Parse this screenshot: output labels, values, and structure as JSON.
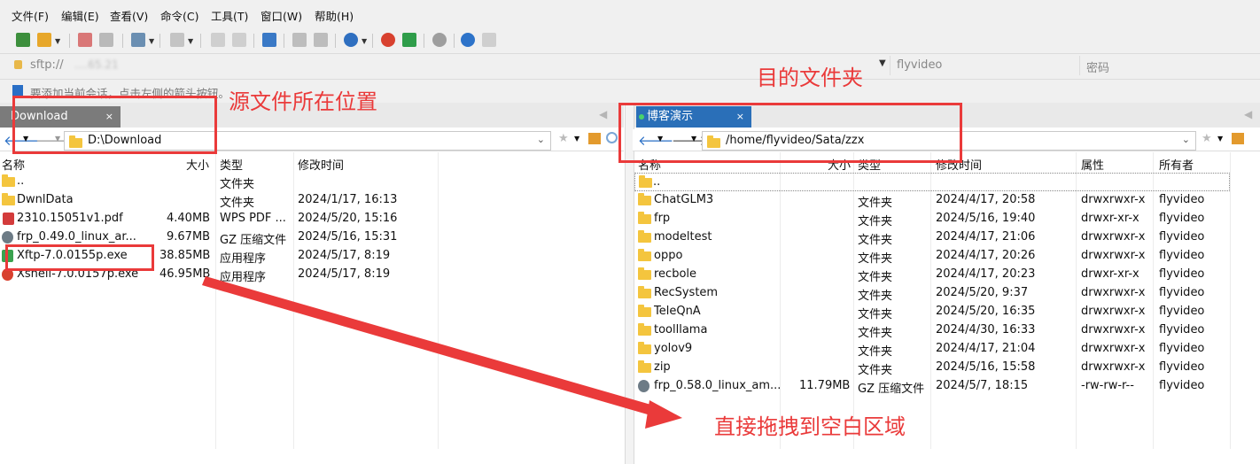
{
  "menu": [
    "文件(F)",
    "编辑(E)",
    "查看(V)",
    "命令(C)",
    "工具(T)",
    "窗口(W)",
    "帮助(H)"
  ],
  "address": {
    "value": "sftp://",
    "host_tail": "....65.21",
    "username": "flyvideo",
    "password_placeholder": "密码"
  },
  "hint": "要添加当前会话，点击左侧的箭头按钮。",
  "left_pane": {
    "tab": "Download",
    "tab_close": "×",
    "path": "D:\\Download",
    "columns": [
      "名称",
      "大小",
      "类型",
      "修改时间"
    ],
    "rows": [
      {
        "name": "..",
        "size": "",
        "type": "文件夹",
        "modified": "",
        "icon": "folder"
      },
      {
        "name": "DwnlData",
        "size": "",
        "type": "文件夹",
        "modified": "2024/1/17, 16:13",
        "icon": "folder"
      },
      {
        "name": "2310.15051v1.pdf",
        "size": "4.40MB",
        "type": "WPS PDF ...",
        "modified": "2024/5/20, 15:16",
        "icon": "pdf"
      },
      {
        "name": "frp_0.49.0_linux_ar...",
        "size": "9.67MB",
        "type": "GZ 压缩文件",
        "modified": "2024/5/16, 15:31",
        "icon": "gz"
      },
      {
        "name": "Xftp-7.0.0155p.exe",
        "size": "38.85MB",
        "type": "应用程序",
        "modified": "2024/5/17, 8:19",
        "icon": "xftp"
      },
      {
        "name": "Xshell-7.0.0157p.exe",
        "size": "46.95MB",
        "type": "应用程序",
        "modified": "2024/5/17, 8:19",
        "icon": "xshell"
      }
    ]
  },
  "right_pane": {
    "tab": "博客演示",
    "tab_close": "×",
    "path": "/home/flyvideo/Sata/zzx",
    "columns": [
      "名称",
      "大小",
      "类型",
      "修改时间",
      "属性",
      "所有者"
    ],
    "rows": [
      {
        "name": "..",
        "size": "",
        "type": "",
        "modified": "",
        "perm": "",
        "owner": "",
        "icon": "folder"
      },
      {
        "name": "ChatGLM3",
        "size": "",
        "type": "文件夹",
        "modified": "2024/4/17, 20:58",
        "perm": "drwxrwxr-x",
        "owner": "flyvideo",
        "icon": "folder"
      },
      {
        "name": "frp",
        "size": "",
        "type": "文件夹",
        "modified": "2024/5/16, 19:40",
        "perm": "drwxr-xr-x",
        "owner": "flyvideo",
        "icon": "folder"
      },
      {
        "name": "modeltest",
        "size": "",
        "type": "文件夹",
        "modified": "2024/4/17, 21:06",
        "perm": "drwxrwxr-x",
        "owner": "flyvideo",
        "icon": "folder"
      },
      {
        "name": "oppo",
        "size": "",
        "type": "文件夹",
        "modified": "2024/4/17, 20:26",
        "perm": "drwxrwxr-x",
        "owner": "flyvideo",
        "icon": "folder"
      },
      {
        "name": "recbole",
        "size": "",
        "type": "文件夹",
        "modified": "2024/4/17, 20:23",
        "perm": "drwxr-xr-x",
        "owner": "flyvideo",
        "icon": "folder"
      },
      {
        "name": "RecSystem",
        "size": "",
        "type": "文件夹",
        "modified": "2024/5/20, 9:37",
        "perm": "drwxrwxr-x",
        "owner": "flyvideo",
        "icon": "folder"
      },
      {
        "name": "TeleQnA",
        "size": "",
        "type": "文件夹",
        "modified": "2024/5/20, 16:35",
        "perm": "drwxrwxr-x",
        "owner": "flyvideo",
        "icon": "folder"
      },
      {
        "name": "toolllama",
        "size": "",
        "type": "文件夹",
        "modified": "2024/4/30, 16:33",
        "perm": "drwxrwxr-x",
        "owner": "flyvideo",
        "icon": "folder"
      },
      {
        "name": "yolov9",
        "size": "",
        "type": "文件夹",
        "modified": "2024/4/17, 21:04",
        "perm": "drwxrwxr-x",
        "owner": "flyvideo",
        "icon": "folder"
      },
      {
        "name": "zip",
        "size": "",
        "type": "文件夹",
        "modified": "2024/5/16, 15:58",
        "perm": "drwxrwxr-x",
        "owner": "flyvideo",
        "icon": "folder"
      },
      {
        "name": "frp_0.58.0_linux_am...",
        "size": "11.79MB",
        "type": "GZ 压缩文件",
        "modified": "2024/5/7, 18:15",
        "perm": "-rw-rw-r--",
        "owner": "flyvideo",
        "icon": "gz"
      }
    ]
  },
  "annotations": {
    "source_label": "源文件所在位置",
    "target_label": "目的文件夹",
    "drag_label": "直接拖拽到空白区域",
    "color": "#ea3a3a"
  },
  "colors": {
    "accent": "#1e73be",
    "tab_active_right": "#2a6fb8",
    "folder": "#f4c53e"
  }
}
